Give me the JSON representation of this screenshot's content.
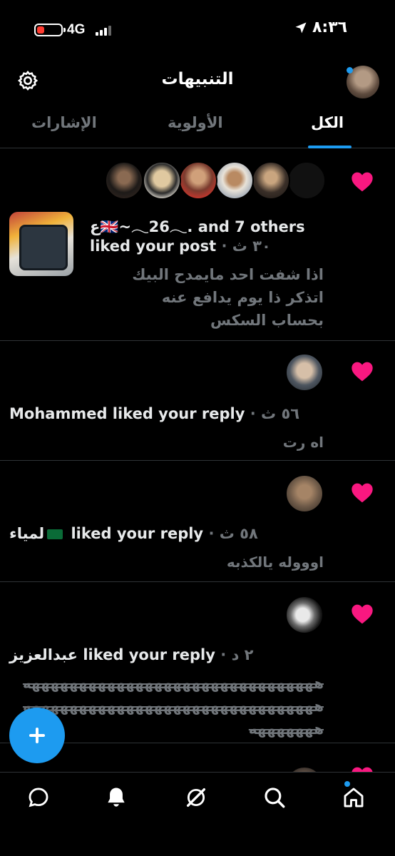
{
  "status_bar": {
    "network": "4G",
    "time": "٨:٣٦",
    "battery_level": 0.25,
    "battery_color": "#ff3b30"
  },
  "header": {
    "title": "التنبيهات",
    "settings_icon": "gear-icon"
  },
  "tabs": [
    {
      "label": "الكل",
      "active": true
    },
    {
      "label": "الأولوية",
      "active": false
    },
    {
      "label": "الإشارات",
      "active": false
    }
  ],
  "notifications": [
    {
      "type": "like",
      "actors_line": "ع🇬🇧~𓂃26𓂃. and 7 others",
      "action": "liked your post",
      "time": "٣٠ ث",
      "text_lines": [
        "اذا شفت احد مايمدح البيك",
        "اتذكر ذا يوم يدافع عنه",
        "بحساب السكس"
      ]
    },
    {
      "type": "like",
      "name": "Mohammed",
      "action": "liked your reply",
      "time": "٥٦ ث",
      "text_lines": [
        "اه رت"
      ]
    },
    {
      "type": "like",
      "name": "لمياء",
      "action": "liked your reply",
      "time": "٥٨ ث",
      "text_lines": [
        "اوووله يالكذبه"
      ]
    },
    {
      "type": "like",
      "name": "عبدالعزيز",
      "action": "liked your reply",
      "time": "٢ د",
      "text_lines": [
        "هههههههههههههههههههههههههههههههه",
        "هههههههههههههههههههههههههههههههه",
        "هههههههه"
      ]
    }
  ],
  "colors": {
    "accent": "#1d9bf0",
    "heart": "#f91880",
    "text": "#e7e9ea",
    "muted": "#71767b"
  },
  "fab": {
    "icon": "plus-icon"
  },
  "bottom_nav": [
    "home-icon",
    "search-icon",
    "grok-icon",
    "notifications-icon",
    "messages-icon"
  ]
}
